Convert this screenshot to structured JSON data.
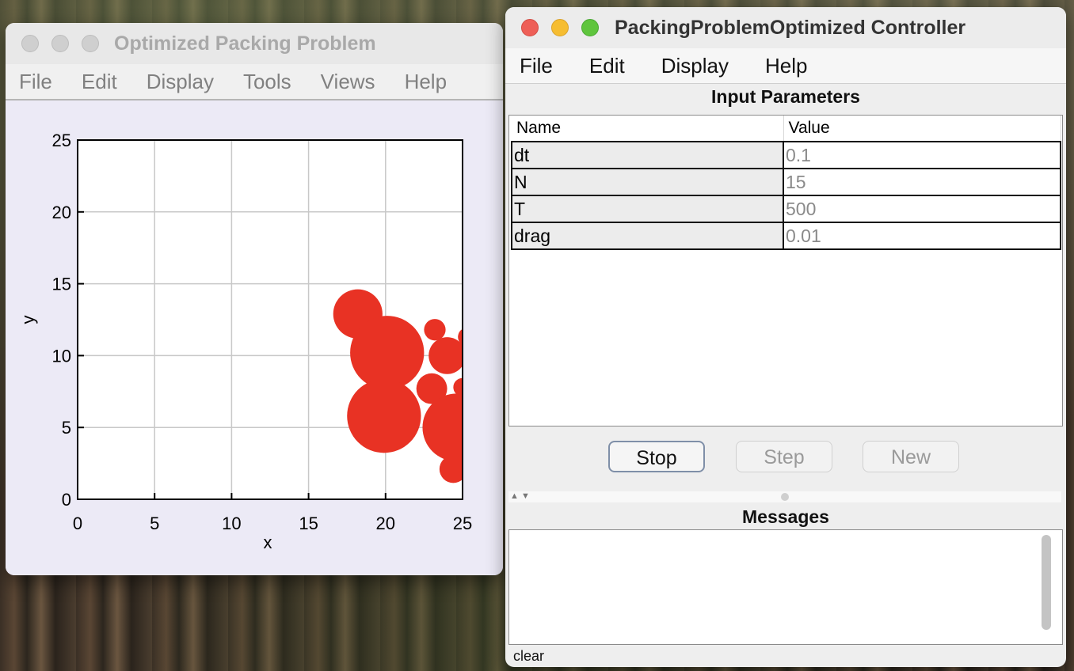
{
  "left_window": {
    "title": "Optimized Packing Problem",
    "menu": [
      "File",
      "Edit",
      "Display",
      "Tools",
      "Views",
      "Help"
    ]
  },
  "right_window": {
    "title": "PackingProblemOptimized Controller",
    "menu": [
      "File",
      "Edit",
      "Display",
      "Help"
    ],
    "input_parameters_title": "Input Parameters",
    "table_headers": {
      "name": "Name",
      "value": "Value"
    },
    "parameters": [
      {
        "name": "dt",
        "value": "0.1"
      },
      {
        "name": "N",
        "value": "15"
      },
      {
        "name": "T",
        "value": "500"
      },
      {
        "name": "drag",
        "value": "0.01"
      }
    ],
    "buttons": {
      "stop": "Stop",
      "step": "Step",
      "new": "New"
    },
    "messages_title": "Messages",
    "messages_text": "",
    "clear_label": "clear"
  },
  "colors": {
    "disk": "#e83224",
    "grid": "#c8c8c8"
  },
  "chart_data": {
    "type": "scatter",
    "xlabel": "x",
    "ylabel": "y",
    "xlim": [
      0,
      25
    ],
    "ylim": [
      0,
      25
    ],
    "xticks": [
      0,
      5,
      10,
      15,
      20,
      25
    ],
    "yticks": [
      0,
      5,
      10,
      15,
      20,
      25
    ],
    "grid": true,
    "disks": [
      {
        "x": 18.2,
        "y": 12.9,
        "r": 1.6
      },
      {
        "x": 20.1,
        "y": 10.2,
        "r": 2.4
      },
      {
        "x": 19.9,
        "y": 5.8,
        "r": 2.4
      },
      {
        "x": 23.2,
        "y": 11.8,
        "r": 0.7
      },
      {
        "x": 24.0,
        "y": 10.0,
        "r": 1.2
      },
      {
        "x": 23.0,
        "y": 7.7,
        "r": 1.0
      },
      {
        "x": 25.0,
        "y": 7.8,
        "r": 0.6
      },
      {
        "x": 25.3,
        "y": 11.3,
        "r": 0.6
      },
      {
        "x": 24.6,
        "y": 5.0,
        "r": 2.2
      },
      {
        "x": 24.4,
        "y": 2.1,
        "r": 0.9
      }
    ]
  }
}
